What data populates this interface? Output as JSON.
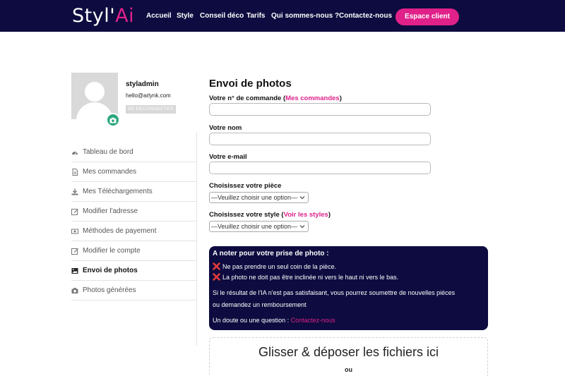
{
  "header": {
    "logo_main": "Styl'",
    "logo_accent": "Ai",
    "nav": [
      "Accueil",
      "Style",
      "Conseil déco",
      "Tarifs",
      "Qui sommes-nous ?",
      "Contactez-nous"
    ],
    "client_button": "Espace client",
    "colors": {
      "navy": "#0d0b3f",
      "accent": "#e0218a"
    }
  },
  "profile": {
    "username": "styladmin",
    "email": "hello@arlynk.com",
    "logout_label": "SE DÉCONNECTER",
    "avatar_badge_icon": "camera-icon"
  },
  "sidebar": {
    "items": [
      {
        "label": "Tableau de bord",
        "icon": "dashboard-icon",
        "active": false
      },
      {
        "label": "Mes commandes",
        "icon": "file-icon",
        "active": false
      },
      {
        "label": "Mes Téléchargements",
        "icon": "download-icon",
        "active": false
      },
      {
        "label": "Modifier l'adresse",
        "icon": "edit-icon",
        "active": false
      },
      {
        "label": "Méthodes de payement",
        "icon": "money-icon",
        "active": false
      },
      {
        "label": "Modifier le compte",
        "icon": "edit-icon",
        "active": false
      },
      {
        "label": "Envoi de photos",
        "icon": "image-icon",
        "active": true
      },
      {
        "label": "Photos générées",
        "icon": "camera-icon",
        "active": false
      }
    ]
  },
  "form": {
    "title": "Envoi de photos",
    "order_label_pre": "Votre n° de commande (",
    "order_label_link": "Mes commandes",
    "order_label_post": ")",
    "order_value": "",
    "name_label": "Votre nom",
    "name_value": "",
    "email_label": "Votre e-mail",
    "email_value": "",
    "room_label": "Choisissez votre pièce",
    "room_select": "—Veuillez choisir une option—",
    "style_label_pre": "Choisissez votre style (",
    "style_label_link": "Voir les styles",
    "style_label_post": ")",
    "style_select": "—Veuillez choisir une option—"
  },
  "notice": {
    "heading": "A noter pour votre prise de photo :",
    "rule1": "Ne pas prendre un seul coin de la pièce.",
    "rule2": "La photo ne doit pas être inclinée ni vers le haut ni vers le bas.",
    "info_line1": "Si le résultat de l'IA n'est pas satisfaisant, vous pourrez soumettre de nouvelles pièces",
    "info_line2": "ou demandez un remboursement",
    "question": "Un doute ou une question : ",
    "contact_link": "Contactez-nous"
  },
  "dropzone": {
    "title": "Glisser & déposer les fichiers ici",
    "or": "ou"
  }
}
